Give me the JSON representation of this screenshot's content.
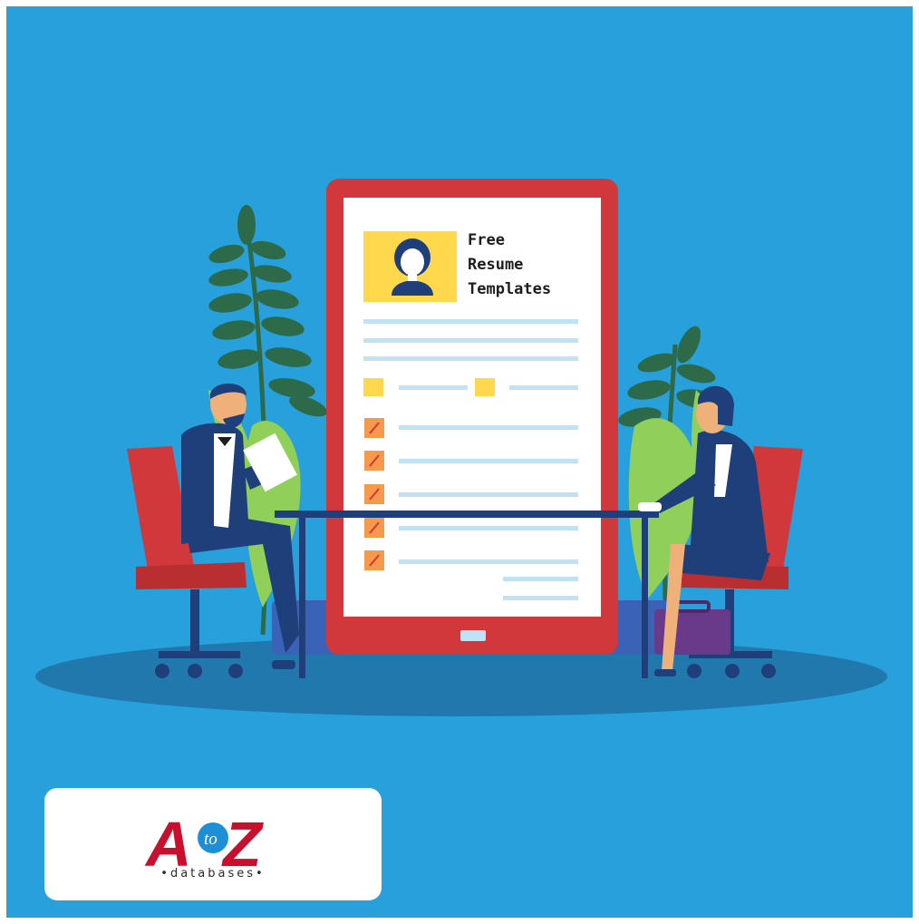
{
  "resume": {
    "title_line1": "Free",
    "title_line2": "Resume",
    "title_line3": "Templates"
  },
  "logo": {
    "letter_a": "A",
    "letter_to": "to",
    "letter_z": "Z",
    "tagline": "•databases•"
  },
  "colors": {
    "background": "#27a0dc",
    "tablet_frame": "#d0383b",
    "chair": "#d0383b",
    "suit": "#1f3f7a",
    "leaf_dark": "#2d6a4a",
    "leaf_light": "#8fcf5a",
    "highlight_yellow": "#ffd84d",
    "checkbox_orange": "#f59a4a",
    "line_blue": "#bfe3f5",
    "logo_red": "#c8102e",
    "logo_blue": "#1c8fd6"
  }
}
